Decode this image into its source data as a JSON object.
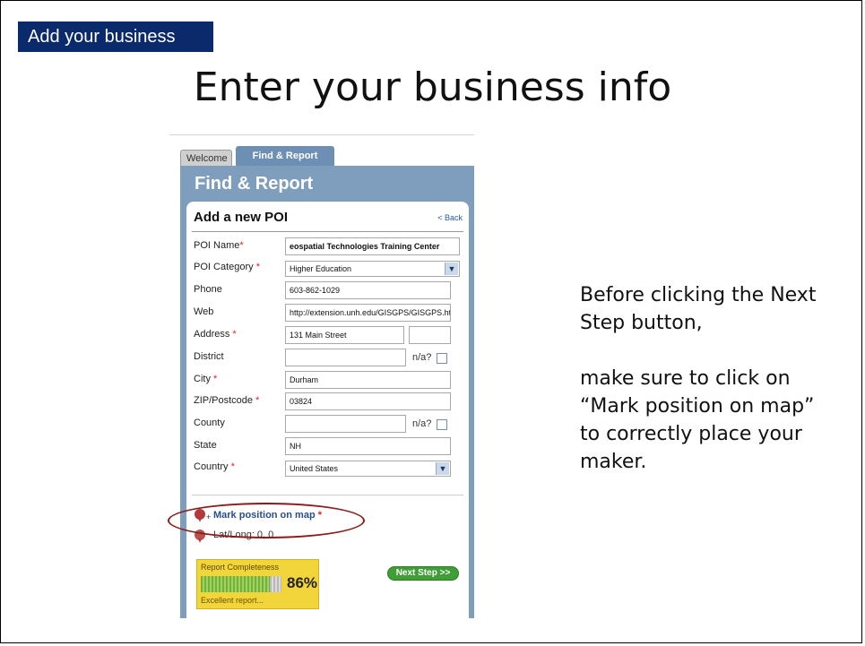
{
  "slide": {
    "corner_label": "Add your business",
    "title": "Enter your business info",
    "instruction_line1": "Before clicking the Next Step button,",
    "instruction_line2": "make sure to click on “Mark position on map” to correctly place your maker."
  },
  "app": {
    "tabs": [
      {
        "label": "Welcome",
        "active": false
      },
      {
        "label": "Find & Report",
        "active": true
      }
    ],
    "panel_title": "Find & Report",
    "form_heading": "Add a new POI",
    "back_link": "< Back",
    "fields": {
      "poi_name": {
        "label": "POI Name",
        "value": "eospatial Technologies Training Center"
      },
      "poi_category": {
        "label": "POI Category",
        "value": "Higher Education"
      },
      "phone": {
        "label": "Phone",
        "value": "603-862-1029"
      },
      "web": {
        "label": "Web",
        "value": "http://extension.unh.edu/GISGPS/GISGPS.htm"
      },
      "address": {
        "label": "Address",
        "value": "131 Main Street",
        "value2": ""
      },
      "district": {
        "label": "District",
        "value": "",
        "na": "n/a?"
      },
      "city": {
        "label": "City",
        "value": "Durham"
      },
      "zip": {
        "label": "ZIP/Postcode",
        "value": "03824"
      },
      "county": {
        "label": "County",
        "value": "",
        "na": "n/a?"
      },
      "state": {
        "label": "State",
        "value": "NH"
      },
      "country": {
        "label": "Country",
        "value": "United States"
      }
    },
    "required_marker": "*",
    "mark_position": "Mark position on map",
    "latlong": "Lat/Long: 0, 0",
    "completeness": {
      "title": "Report Completeness",
      "percent": "86%",
      "fraction": 0.86,
      "note": "Excellent report..."
    },
    "next_button": "Next Step >>"
  },
  "colors": {
    "corner_label_bg": "#0b2a6b",
    "panel_bg": "#7f9dbd",
    "required": "#dd2222",
    "next_button": "#3f9e35",
    "completeness_bg": "#f2d43b",
    "highlight_circle": "#8b1a1a"
  },
  "icons": [
    "map-pin-icon",
    "dropdown-arrow-icon",
    "checkbox-icon"
  ]
}
